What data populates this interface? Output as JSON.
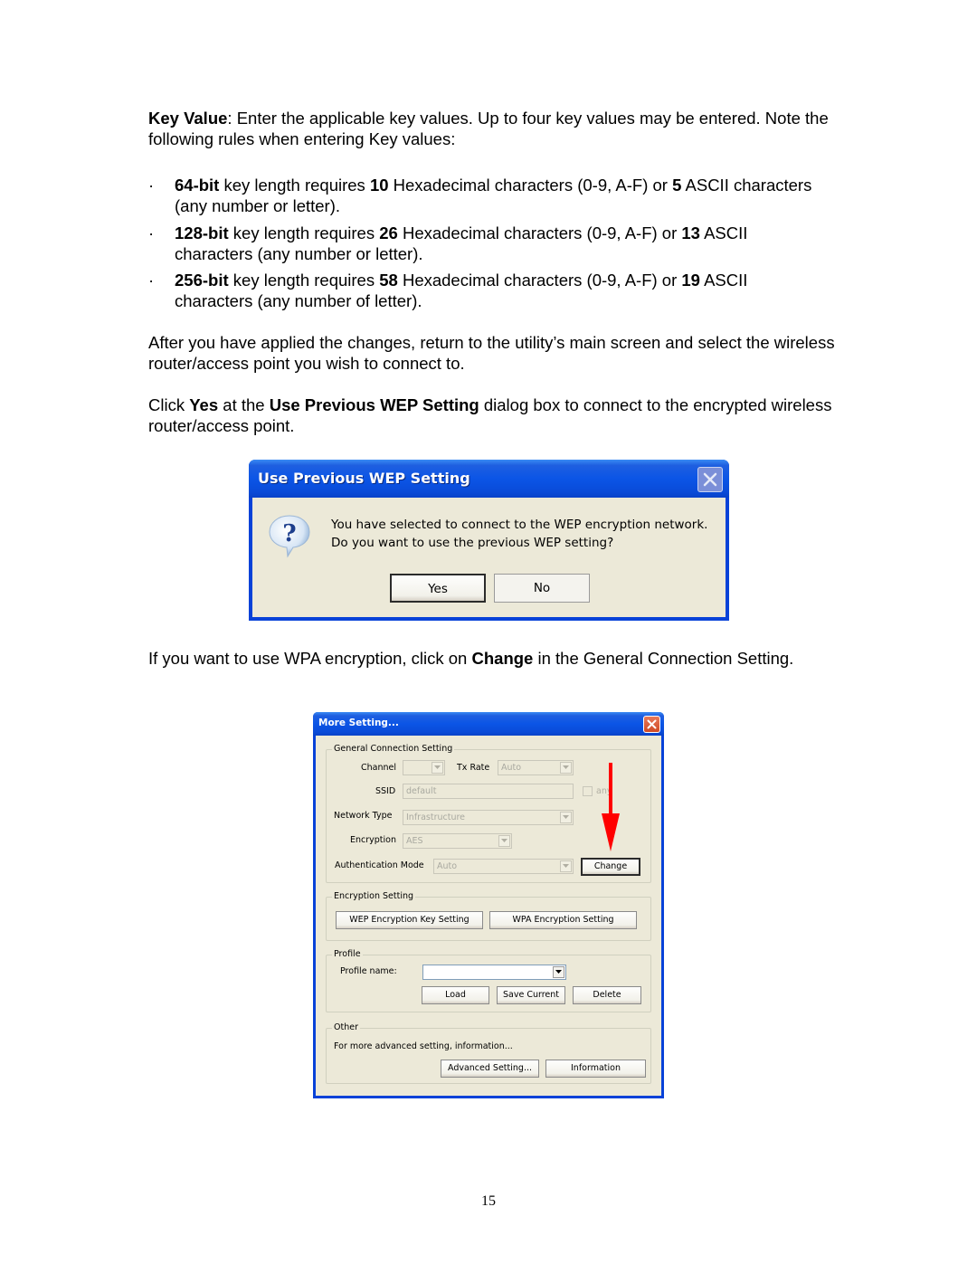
{
  "doc": {
    "intro": {
      "label": "Key Value",
      "text": ": Enter the applicable key values. Up to four key values may be entered. Note the following rules when entering Key values:"
    },
    "bullets": [
      {
        "bits": "64-bit",
        "t1": " key length requires ",
        "hex": "10",
        "t2": " Hexadecimal characters (0-9, A-F) or ",
        "ascii": "5",
        "t3": " ASCII characters (any number or letter)."
      },
      {
        "bits": "128-bit",
        "t1": " key length requires ",
        "hex": "26",
        "t2": " Hexadecimal characters (0-9, A-F) or ",
        "ascii": "13",
        "t3": " ASCII characters (any number or letter)."
      },
      {
        "bits": "256-bit",
        "t1": " key length requires ",
        "hex": "58",
        "t2": " Hexadecimal characters (0-9, A-F) or ",
        "ascii": "19",
        "t3": " ASCII characters (any number of letter)."
      }
    ],
    "bullet_char": "·",
    "after_apply": "After you have applied the changes, return to the utility’s main screen and select the wireless router/access point you wish to connect to.",
    "click_yes": {
      "t1": "Click ",
      "b1": "Yes",
      "t2": " at the ",
      "b2": "Use Previous WEP Setting",
      "t3": " dialog box to connect to the encrypted wireless router/access point."
    },
    "wpa_note": {
      "t1": "If you want to use WPA encryption, click on ",
      "b1": "Change",
      "t2": " in the General Connection Setting."
    },
    "page_number": "15"
  },
  "dialog_wep": {
    "title": "Use Previous WEP Setting",
    "icon": "question-icon",
    "message_line1": "You have selected to connect to the WEP encryption network.",
    "message_line2": "Do you want to use the previous WEP setting?",
    "yes_label": "Yes",
    "no_label": "No"
  },
  "dialog_more": {
    "title": "More Setting...",
    "general": {
      "legend": "General Connection Setting",
      "channel_label": "Channel",
      "channel_value": "",
      "txrate_label": "Tx Rate",
      "txrate_value": "Auto",
      "ssid_label": "SSID",
      "ssid_value": "default",
      "any_label": "any",
      "network_type_label": "Network Type",
      "network_type_value": "Infrastructure",
      "encryption_label": "Encryption",
      "encryption_value": "AES",
      "auth_label": "Authentication Mode",
      "auth_value": "Auto",
      "change_label": "Change"
    },
    "encryption": {
      "legend": "Encryption Setting",
      "wep_btn": "WEP Encryption Key Setting",
      "wpa_btn": "WPA Encryption Setting"
    },
    "profile": {
      "legend": "Profile",
      "name_label": "Profile name:",
      "name_value": "",
      "load_btn": "Load",
      "save_btn": "Save Current",
      "delete_btn": "Delete"
    },
    "other": {
      "legend": "Other",
      "desc": "For more advanced setting, information...",
      "advanced_btn": "Advanced Setting...",
      "info_btn": "Information"
    }
  },
  "annotation": {
    "arrow_color": "#ff0000",
    "points_to": "Change"
  }
}
